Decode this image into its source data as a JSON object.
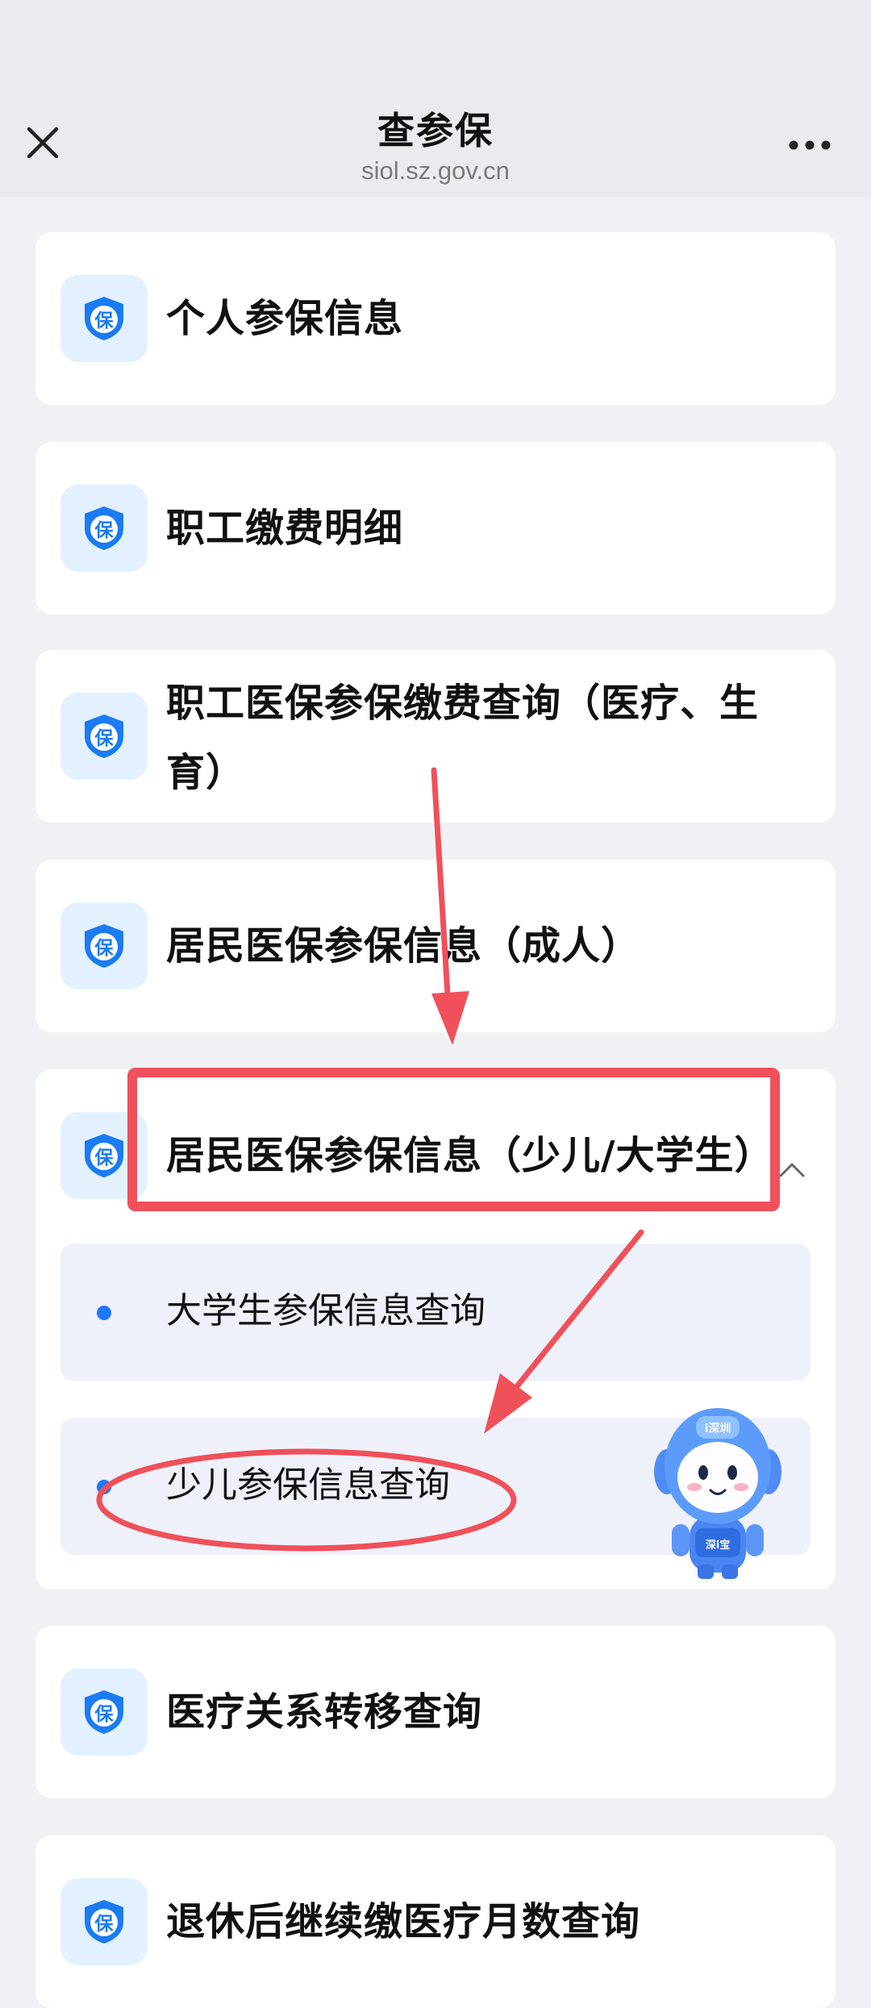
{
  "header": {
    "title": "查参保",
    "url": "siol.sz.gov.cn",
    "close_icon": "close-icon",
    "more_icon": "more-icon"
  },
  "menu": {
    "icon_glyph": "保",
    "items": [
      {
        "label": "个人参保信息"
      },
      {
        "label": "职工缴费明细"
      },
      {
        "label": "职工医保参保缴费查询（医疗、生育）"
      },
      {
        "label": "居民医保参保信息（成人）"
      },
      {
        "label": "居民医保参保信息（少儿/大学生）",
        "expanded": true,
        "children": [
          {
            "label": "大学生参保信息查询"
          },
          {
            "label": "少儿参保信息查询"
          }
        ]
      },
      {
        "label": "医疗关系转移查询"
      },
      {
        "label": "退休后继续缴医疗月数查询"
      }
    ]
  },
  "mascot": {
    "cap_text": "i深圳",
    "body_text": "深i宝"
  },
  "colors": {
    "accent": "#1f78ff",
    "icon_bg": "#e3f1ff",
    "annotation": "#f0505a"
  }
}
